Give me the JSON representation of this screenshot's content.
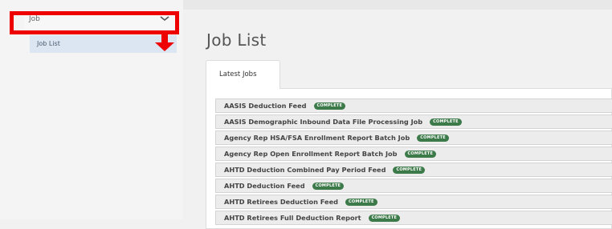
{
  "sidebar": {
    "menu_header": "Job",
    "menu_item": "Job List"
  },
  "main": {
    "title": "Job List",
    "tab_label": "Latest Jobs",
    "jobs": [
      {
        "name": "AASIS Deduction Feed",
        "status": "COMPLETE"
      },
      {
        "name": "AASIS Demographic Inbound Data File Processing Job",
        "status": "COMPLETE"
      },
      {
        "name": "Agency Rep HSA/FSA Enrollment Report Batch Job",
        "status": "COMPLETE"
      },
      {
        "name": "Agency Rep Open Enrollment Report Batch Job",
        "status": "COMPLETE"
      },
      {
        "name": "AHTD Deduction Combined Pay Period Feed",
        "status": "COMPLETE"
      },
      {
        "name": "AHTD Deduction Feed",
        "status": "COMPLETE"
      },
      {
        "name": "AHTD Retirees Deduction Feed",
        "status": "COMPLETE"
      },
      {
        "name": "AHTD Retirees Full Deduction Report",
        "status": "COMPLETE"
      }
    ]
  },
  "colors": {
    "highlight": "#ee0000",
    "badge": "#3d7a4a",
    "selected_item": "#dbe6f2"
  },
  "icons": {
    "chevron": "chevron-down-icon",
    "arrow": "arrow-down-icon"
  }
}
